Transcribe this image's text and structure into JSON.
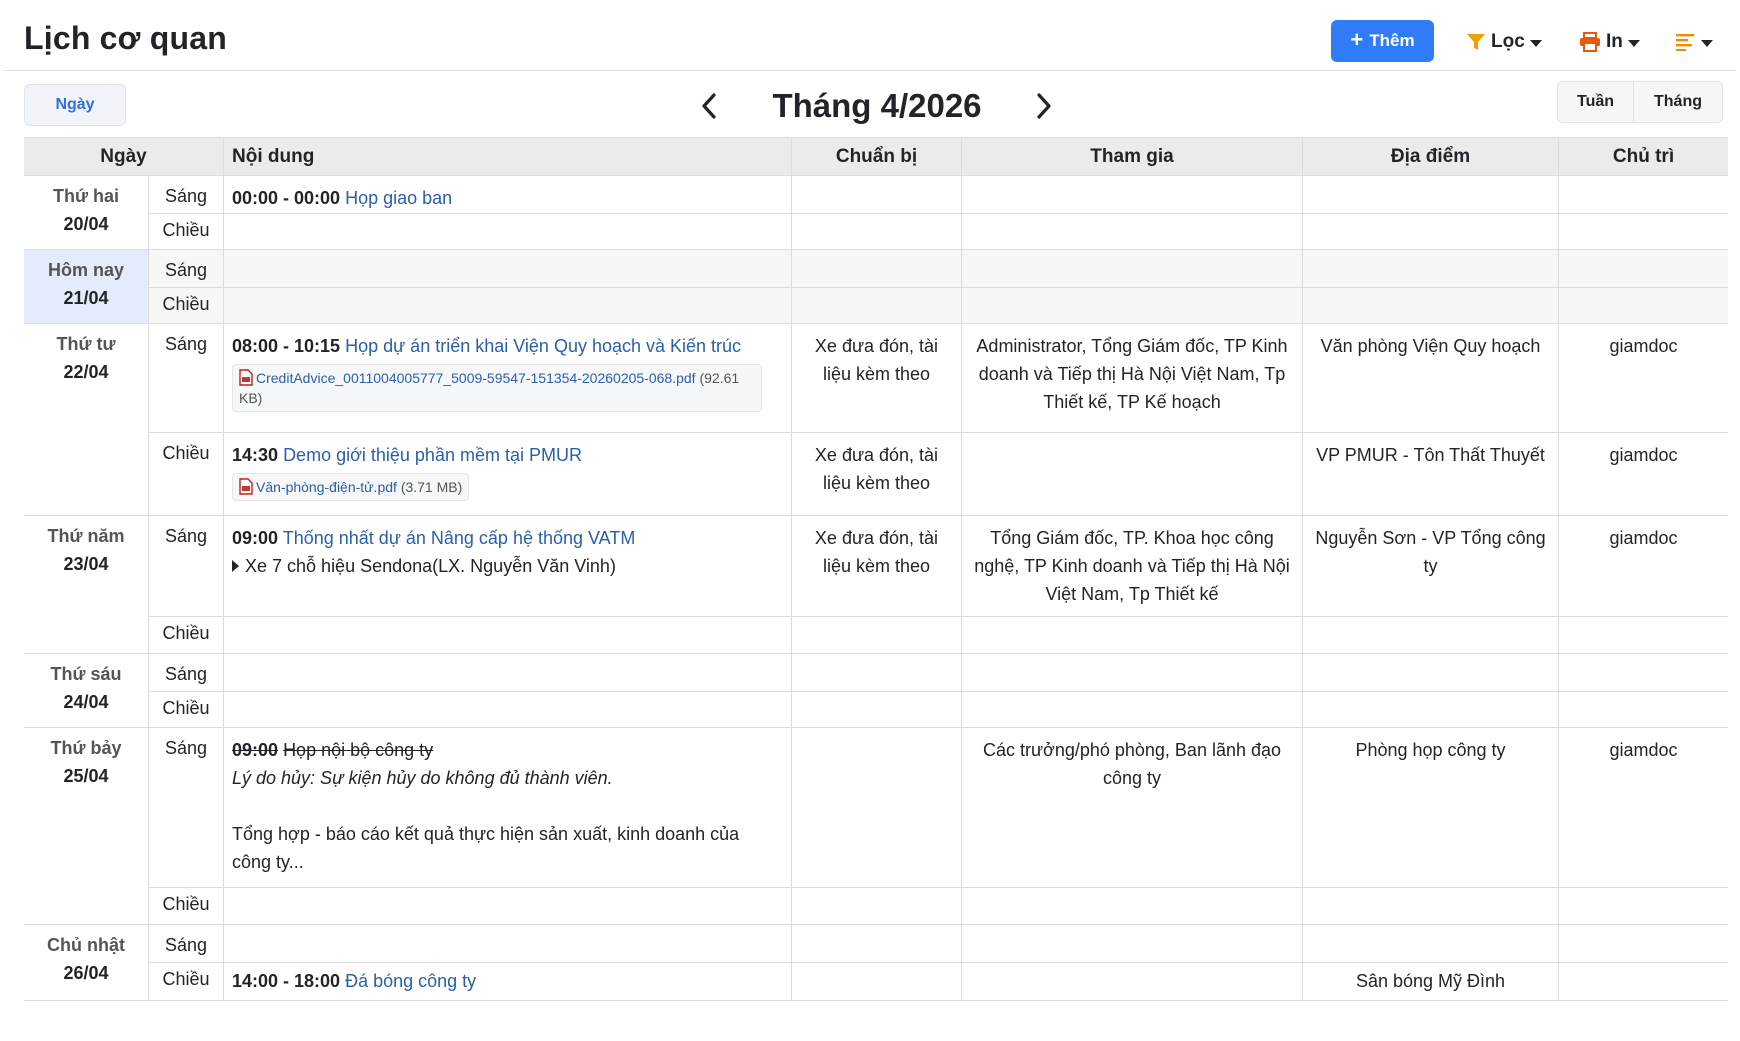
{
  "header": {
    "title": "Lịch cơ quan",
    "add_label": "Thêm",
    "filter_label": "Lọc",
    "print_label": "In"
  },
  "nav": {
    "day_label": "Ngày",
    "month_title": "Tháng 4/2026",
    "week_label": "Tuần",
    "month_label": "Tháng"
  },
  "columns": [
    "Ngày",
    "Nội dung",
    "Chuẩn bị",
    "Tham gia",
    "Địa điểm",
    "Chủ trì"
  ],
  "sessions": {
    "morning": "Sáng",
    "afternoon": "Chiều"
  },
  "days": [
    {
      "name": "Thứ hai",
      "date": "20/04",
      "morning": {
        "time": "00:00 - 00:00",
        "title": "Họp giao ban"
      }
    },
    {
      "name": "Hôm nay",
      "date": "21/04"
    },
    {
      "name": "Thứ tư",
      "date": "22/04",
      "morning": {
        "time": "08:00 - 10:15",
        "title": "Họp dự án triển khai Viện Quy hoạch và Kiến trúc",
        "attachment": {
          "name": "CreditAdvice_0011004005777_5009-59547-151354-20260205-068.pdf",
          "size": "(92.61 KB)"
        },
        "prep": "Xe đưa đón, tài liệu kèm theo",
        "participants": "Administrator, Tổng Giám đốc, TP Kinh doanh và Tiếp thị Hà Nội Việt Nam, Tp Thiết kế, TP Kế hoạch",
        "place": "Văn phòng Viện Quy hoạch",
        "host": "giamdoc"
      },
      "afternoon": {
        "time": "14:30",
        "title": "Demo giới thiệu phần mềm tại PMUR",
        "attachment": {
          "name": "Văn-phòng-điện-tử.pdf",
          "size": "(3.71 MB)"
        },
        "prep": "Xe đưa đón, tài liệu kèm theo",
        "place": "VP PMUR - Tôn Thất Thuyết",
        "host": "giamdoc"
      }
    },
    {
      "name": "Thứ năm",
      "date": "23/04",
      "morning": {
        "time": "09:00",
        "title": "Thống nhất dự án Nâng cấp hệ thống VATM",
        "vehicle": "Xe 7 chỗ hiệu Sendona(LX. Nguyễn Văn Vinh)",
        "prep": "Xe đưa đón, tài liệu kèm theo",
        "participants": "Tổng Giám đốc, TP. Khoa học công nghệ, TP Kinh doanh và Tiếp thị Hà Nội Việt Nam, Tp Thiết kế",
        "place": "Nguyễn Sơn - VP Tổng công ty",
        "host": "giamdoc"
      }
    },
    {
      "name": "Thứ sáu",
      "date": "24/04"
    },
    {
      "name": "Thứ bảy",
      "date": "25/04",
      "morning": {
        "time": "09:00",
        "title": "Họp nội bộ công ty",
        "reason": "Lý do hủy: Sự kiện hủy do không đủ thành viên.",
        "description": "Tổng hợp - báo cáo kết quả thực hiện sản xuất, kinh doanh của công ty...",
        "participants": "Các trưởng/phó phòng, Ban lãnh đạo công ty",
        "place": "Phòng họp công ty",
        "host": "giamdoc"
      }
    },
    {
      "name": "Chủ nhật",
      "date": "26/04",
      "afternoon": {
        "time": "14:00 - 18:00",
        "title": "Đá bóng công ty",
        "place": "Sân bóng Mỹ Đình"
      }
    }
  ],
  "colors": {
    "primary": "#2f7cf6",
    "filter": "#f0a000",
    "print": "#e8590c",
    "menu": "#f08c00",
    "event_link": "#2a5fab",
    "today_bg": "#e4ecfb"
  },
  "icons": {
    "add": "plus-icon",
    "filter": "funnel-icon",
    "print": "printer-icon",
    "menu": "list-icon",
    "prev": "chevron-left-icon",
    "next": "chevron-right-icon",
    "attachment": "pdf-file-icon",
    "expand": "caret-right-icon"
  }
}
